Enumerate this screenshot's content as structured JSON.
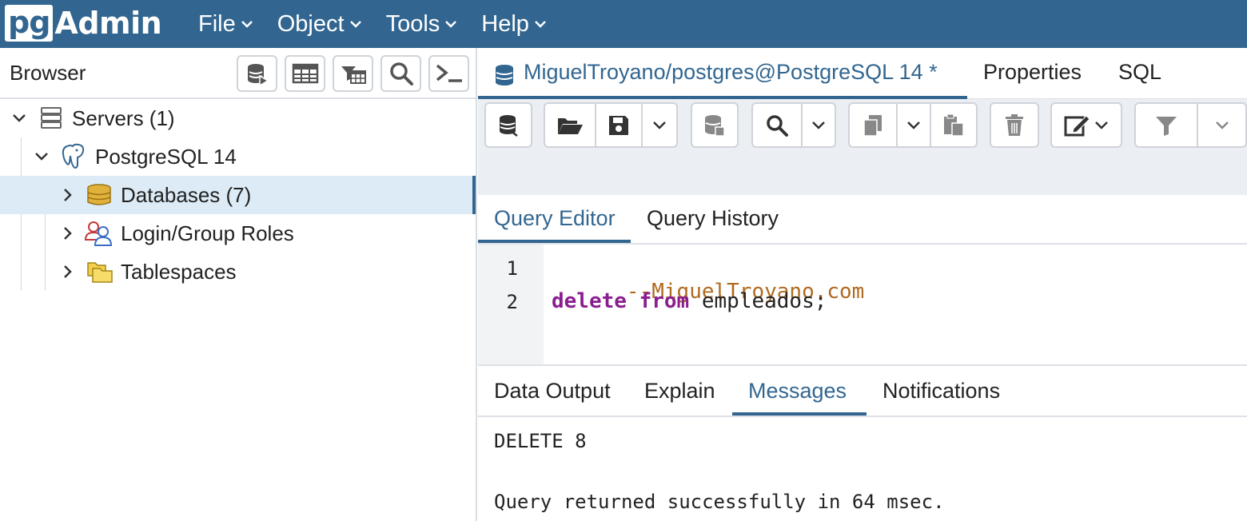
{
  "app": {
    "logo_pg": "pg",
    "logo_admin": "Admin"
  },
  "menu": [
    {
      "label": "File"
    },
    {
      "label": "Object"
    },
    {
      "label": "Tools"
    },
    {
      "label": "Help"
    }
  ],
  "browser": {
    "title": "Browser",
    "toolbar_icons": [
      "database-query-icon",
      "table-grid-icon",
      "filtered-rows-icon",
      "search-icon",
      "terminal-icon"
    ],
    "tree": [
      {
        "label": "Servers (1)",
        "icon": "servers-icon",
        "expanded": true
      },
      {
        "label": "PostgreSQL 14",
        "icon": "postgres-elephant-icon",
        "expanded": true
      },
      {
        "label": "Databases (7)",
        "icon": "databases-icon",
        "expanded": false,
        "selected": true
      },
      {
        "label": "Login/Group Roles",
        "icon": "roles-icon",
        "expanded": false
      },
      {
        "label": "Tablespaces",
        "icon": "tablespaces-folder-icon",
        "expanded": false
      }
    ]
  },
  "main_tabs": {
    "query_tab": "MiguelTroyano/postgres@PostgreSQL 14 *",
    "properties": "Properties",
    "sql": "SQL"
  },
  "editor_tabs": {
    "query_editor": "Query Editor",
    "query_history": "Query History"
  },
  "editor": {
    "line_numbers": [
      "1",
      "2"
    ],
    "line1": "--MiguelTroyano.com",
    "line2_kw1": "delete",
    "line2_kw2": "from",
    "line2_rest": " empleados;"
  },
  "output_tabs": {
    "data_output": "Data Output",
    "explain": "Explain",
    "messages": "Messages",
    "notifications": "Notifications",
    "active": "Messages"
  },
  "output": {
    "line1": "DELETE 8",
    "line2": "Query returned successfully in 64 msec."
  },
  "colors": {
    "brand": "#326690",
    "selected_row": "#dcebf6",
    "comment": "#b06a1f",
    "keyword": "#8a1e8f"
  }
}
